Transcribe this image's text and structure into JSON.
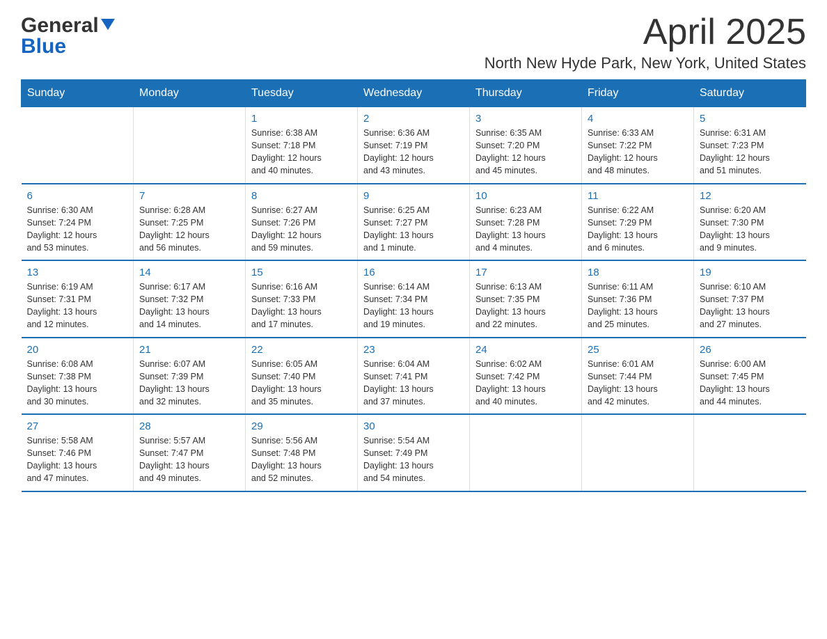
{
  "header": {
    "logo_general": "General",
    "logo_blue": "Blue",
    "month": "April 2025",
    "location": "North New Hyde Park, New York, United States"
  },
  "weekdays": [
    "Sunday",
    "Monday",
    "Tuesday",
    "Wednesday",
    "Thursday",
    "Friday",
    "Saturday"
  ],
  "weeks": [
    [
      {
        "day": "",
        "info": ""
      },
      {
        "day": "",
        "info": ""
      },
      {
        "day": "1",
        "info": "Sunrise: 6:38 AM\nSunset: 7:18 PM\nDaylight: 12 hours\nand 40 minutes."
      },
      {
        "day": "2",
        "info": "Sunrise: 6:36 AM\nSunset: 7:19 PM\nDaylight: 12 hours\nand 43 minutes."
      },
      {
        "day": "3",
        "info": "Sunrise: 6:35 AM\nSunset: 7:20 PM\nDaylight: 12 hours\nand 45 minutes."
      },
      {
        "day": "4",
        "info": "Sunrise: 6:33 AM\nSunset: 7:22 PM\nDaylight: 12 hours\nand 48 minutes."
      },
      {
        "day": "5",
        "info": "Sunrise: 6:31 AM\nSunset: 7:23 PM\nDaylight: 12 hours\nand 51 minutes."
      }
    ],
    [
      {
        "day": "6",
        "info": "Sunrise: 6:30 AM\nSunset: 7:24 PM\nDaylight: 12 hours\nand 53 minutes."
      },
      {
        "day": "7",
        "info": "Sunrise: 6:28 AM\nSunset: 7:25 PM\nDaylight: 12 hours\nand 56 minutes."
      },
      {
        "day": "8",
        "info": "Sunrise: 6:27 AM\nSunset: 7:26 PM\nDaylight: 12 hours\nand 59 minutes."
      },
      {
        "day": "9",
        "info": "Sunrise: 6:25 AM\nSunset: 7:27 PM\nDaylight: 13 hours\nand 1 minute."
      },
      {
        "day": "10",
        "info": "Sunrise: 6:23 AM\nSunset: 7:28 PM\nDaylight: 13 hours\nand 4 minutes."
      },
      {
        "day": "11",
        "info": "Sunrise: 6:22 AM\nSunset: 7:29 PM\nDaylight: 13 hours\nand 6 minutes."
      },
      {
        "day": "12",
        "info": "Sunrise: 6:20 AM\nSunset: 7:30 PM\nDaylight: 13 hours\nand 9 minutes."
      }
    ],
    [
      {
        "day": "13",
        "info": "Sunrise: 6:19 AM\nSunset: 7:31 PM\nDaylight: 13 hours\nand 12 minutes."
      },
      {
        "day": "14",
        "info": "Sunrise: 6:17 AM\nSunset: 7:32 PM\nDaylight: 13 hours\nand 14 minutes."
      },
      {
        "day": "15",
        "info": "Sunrise: 6:16 AM\nSunset: 7:33 PM\nDaylight: 13 hours\nand 17 minutes."
      },
      {
        "day": "16",
        "info": "Sunrise: 6:14 AM\nSunset: 7:34 PM\nDaylight: 13 hours\nand 19 minutes."
      },
      {
        "day": "17",
        "info": "Sunrise: 6:13 AM\nSunset: 7:35 PM\nDaylight: 13 hours\nand 22 minutes."
      },
      {
        "day": "18",
        "info": "Sunrise: 6:11 AM\nSunset: 7:36 PM\nDaylight: 13 hours\nand 25 minutes."
      },
      {
        "day": "19",
        "info": "Sunrise: 6:10 AM\nSunset: 7:37 PM\nDaylight: 13 hours\nand 27 minutes."
      }
    ],
    [
      {
        "day": "20",
        "info": "Sunrise: 6:08 AM\nSunset: 7:38 PM\nDaylight: 13 hours\nand 30 minutes."
      },
      {
        "day": "21",
        "info": "Sunrise: 6:07 AM\nSunset: 7:39 PM\nDaylight: 13 hours\nand 32 minutes."
      },
      {
        "day": "22",
        "info": "Sunrise: 6:05 AM\nSunset: 7:40 PM\nDaylight: 13 hours\nand 35 minutes."
      },
      {
        "day": "23",
        "info": "Sunrise: 6:04 AM\nSunset: 7:41 PM\nDaylight: 13 hours\nand 37 minutes."
      },
      {
        "day": "24",
        "info": "Sunrise: 6:02 AM\nSunset: 7:42 PM\nDaylight: 13 hours\nand 40 minutes."
      },
      {
        "day": "25",
        "info": "Sunrise: 6:01 AM\nSunset: 7:44 PM\nDaylight: 13 hours\nand 42 minutes."
      },
      {
        "day": "26",
        "info": "Sunrise: 6:00 AM\nSunset: 7:45 PM\nDaylight: 13 hours\nand 44 minutes."
      }
    ],
    [
      {
        "day": "27",
        "info": "Sunrise: 5:58 AM\nSunset: 7:46 PM\nDaylight: 13 hours\nand 47 minutes."
      },
      {
        "day": "28",
        "info": "Sunrise: 5:57 AM\nSunset: 7:47 PM\nDaylight: 13 hours\nand 49 minutes."
      },
      {
        "day": "29",
        "info": "Sunrise: 5:56 AM\nSunset: 7:48 PM\nDaylight: 13 hours\nand 52 minutes."
      },
      {
        "day": "30",
        "info": "Sunrise: 5:54 AM\nSunset: 7:49 PM\nDaylight: 13 hours\nand 54 minutes."
      },
      {
        "day": "",
        "info": ""
      },
      {
        "day": "",
        "info": ""
      },
      {
        "day": "",
        "info": ""
      }
    ]
  ],
  "colors": {
    "header_bg": "#1a6fb5",
    "accent": "#1565c0",
    "day_number": "#1a6fb5"
  }
}
